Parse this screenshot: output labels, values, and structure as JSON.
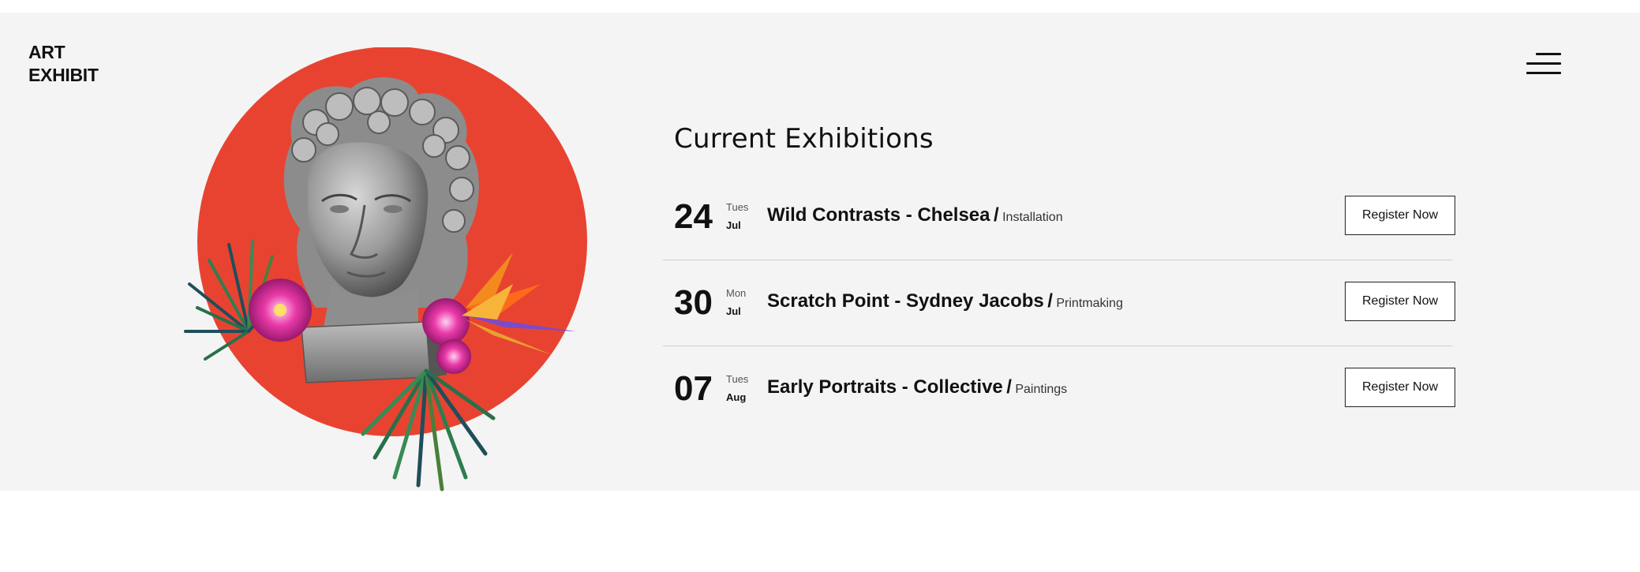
{
  "brand": {
    "logo_line1": "ART",
    "logo_line2": "EXHIBIT"
  },
  "header": {
    "menu_icon": "hamburger-menu-icon"
  },
  "hero": {
    "image": "classical-bust-with-tropical-flowers-on-red-circle",
    "circle_color": "#e84331"
  },
  "exhibitions": {
    "title": "Current Exhibitions",
    "items": [
      {
        "day": "24",
        "weekday": "Tues",
        "month": "Jul",
        "name": "Wild Contrasts - Chelsea",
        "separator": "/",
        "category": "Installation",
        "button_label": "Register Now"
      },
      {
        "day": "30",
        "weekday": "Mon",
        "month": "Jul",
        "name": "Scratch Point - Sydney Jacobs",
        "separator": "/",
        "category": "Printmaking",
        "button_label": "Register Now"
      },
      {
        "day": "07",
        "weekday": "Tues",
        "month": "Aug",
        "name": "Early Portraits - Collective",
        "separator": "/",
        "category": "Paintings",
        "button_label": "Register Now"
      }
    ]
  },
  "colors": {
    "background": "#f4f4f4",
    "accent_red": "#e84331",
    "text": "#111111",
    "divider": "#cfcfcf"
  }
}
